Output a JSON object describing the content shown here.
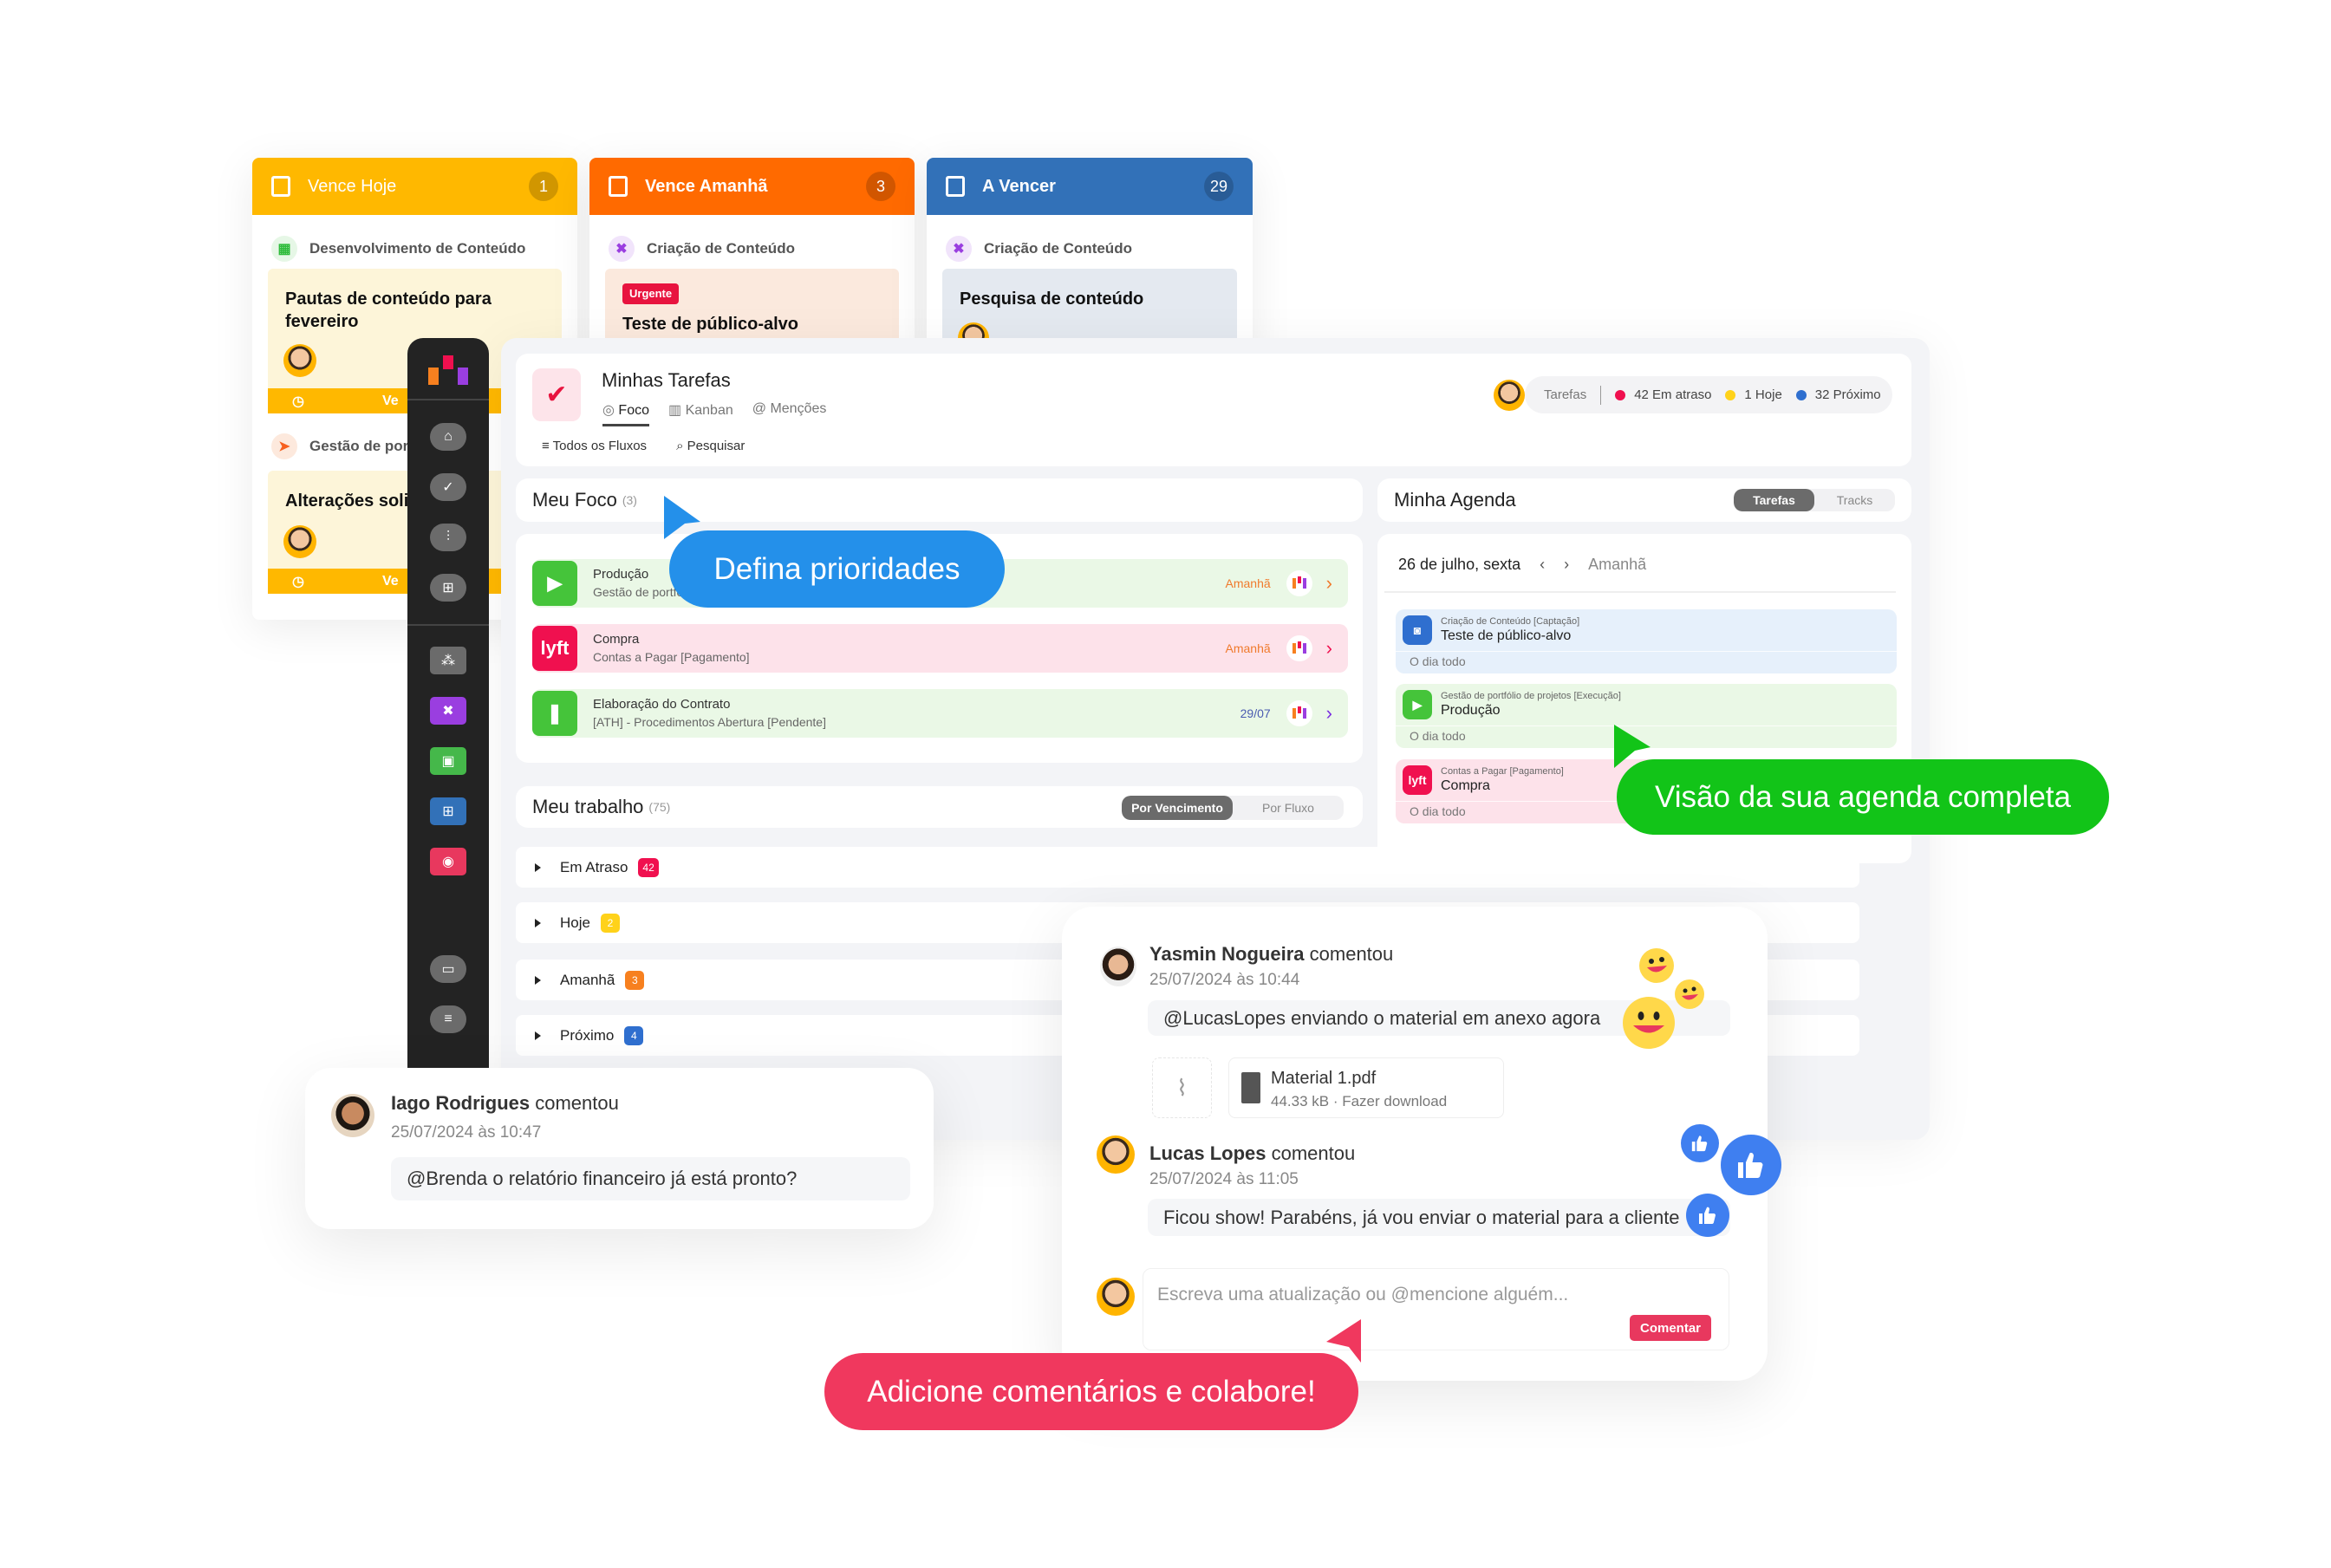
{
  "kanban": {
    "columns": [
      {
        "title": "Vence Hoje",
        "count": "1",
        "color": "#ffb800",
        "groups": [
          {
            "flow": "Desenvolvimento de Conteúdo",
            "card": "Pautas de conteúdo para fevereiro",
            "footer": "Ve"
          },
          {
            "flow": "Gestão de port",
            "card": "Alterações soli",
            "footer": "Ve"
          }
        ]
      },
      {
        "title": "Vence Amanhã",
        "count": "3",
        "color": "#ff6a00",
        "flow": "Criação de Conteúdo",
        "tag": "Urgente",
        "card": "Teste de público-alvo"
      },
      {
        "title": "A Vencer",
        "count": "29",
        "color": "#3271b8",
        "flow": "Criação de Conteúdo",
        "card": "Pesquisa de conteúdo"
      }
    ]
  },
  "sidebar": {
    "icons": [
      "logo-icon",
      "home-icon",
      "check-icon",
      "flows-icon",
      "table-icon",
      "cubes-icon",
      "tools-icon",
      "money-icon",
      "grid-icon",
      "cash-icon",
      "store-icon",
      "menu-icon"
    ]
  },
  "header": {
    "title": "Minhas Tarefas",
    "tabs": [
      {
        "label": "Foco",
        "icon": "◎"
      },
      {
        "label": "Kanban",
        "icon": "▥"
      },
      {
        "label": "Menções",
        "icon": "@"
      }
    ],
    "filters": {
      "flows": "Todos os Fluxos",
      "search": "Pesquisar"
    },
    "stats": {
      "label": "Tarefas",
      "late": "42 Em atraso",
      "today": "1 Hoje",
      "next": "32 Próximo"
    }
  },
  "focus": {
    "title": "Meu Foco",
    "count": "(3)",
    "items": [
      {
        "title": "Produção",
        "sub": "Gestão de portfólio de projetos [Execução]",
        "date": "Amanhã",
        "color": "#45c43a",
        "bg": "#eaf8e6",
        "datecolor": "#f07a2c",
        "chev": "#f07a2c"
      },
      {
        "title": "Compra",
        "sub": "Contas a Pagar [Pagamento]",
        "date": "Amanhã",
        "color": "#f0104f",
        "bg": "#fde2ea",
        "datecolor": "#f07a2c",
        "chev": "#f0104f"
      },
      {
        "title": "Elaboração do Contrato",
        "sub": "[ATH] - Procedimentos Abertura [Pendente]",
        "date": "29/07",
        "color": "#45c43a",
        "bg": "#eaf8e6",
        "datecolor": "#4a5bb0",
        "chev": "#7a2ee0"
      }
    ]
  },
  "work": {
    "title": "Meu trabalho",
    "count": "(75)",
    "toggle": {
      "active": "Por Vencimento",
      "inactive": "Por Fluxo"
    },
    "groups": [
      {
        "label": "Em Atraso",
        "count": "42",
        "color": "#f0104f"
      },
      {
        "label": "Hoje",
        "count": "2",
        "color": "#ffd21a"
      },
      {
        "label": "Amanhã",
        "count": "3",
        "color": "#f7801f"
      },
      {
        "label": "Próximo",
        "count": "4",
        "color": "#2f6fcf"
      }
    ]
  },
  "agenda": {
    "title": "Minha Agenda",
    "toggle": {
      "active": "Tarefas",
      "inactive": "Tracks"
    },
    "date": "26 de julho, sexta",
    "next_label": "Amanhã",
    "events": [
      {
        "flow": "Criação de Conteúdo [Captação]",
        "title": "Teste de público-alvo",
        "time": "O dia todo",
        "color": "#2f6fcf",
        "bg": "#e6f0fb"
      },
      {
        "flow": "Gestão de portfólio de projetos [Execução]",
        "title": "Produção",
        "time": "O dia todo",
        "color": "#45c43a",
        "bg": "#eaf8e6"
      },
      {
        "flow": "Contas a Pagar [Pagamento]",
        "title": "Compra",
        "time": "O dia todo",
        "color": "#f0104f",
        "bg": "#fde2ea"
      }
    ]
  },
  "callouts": {
    "priorities": {
      "text": "Defina prioridades",
      "color": "#2490ea"
    },
    "agenda": {
      "text": "Visão da sua agenda completa",
      "color": "#12c418"
    },
    "comments": {
      "text": "Adicione comentários e colabore!",
      "color": "#f0385e"
    }
  },
  "comments": {
    "left": {
      "author": "Iago Rodrigues",
      "verb": "comentou",
      "date": "25/07/2024 às 10:47",
      "text": "@Brenda o relatório financeiro já está pronto?"
    },
    "thread": [
      {
        "author": "Yasmin Nogueira",
        "verb": "comentou",
        "date": "25/07/2024 às 10:44",
        "text": "@LucasLopes enviando o material em anexo agora"
      },
      {
        "author": "Lucas Lopes",
        "verb": "comentou",
        "date": "25/07/2024 às 11:05",
        "text": "Ficou show! Parabéns, já vou enviar o material para a cliente"
      }
    ],
    "attachment": {
      "name": "Material 1.pdf",
      "meta": "44.33 kB · Fazer download"
    },
    "input_placeholder": "Escreva uma atualização ou @mencione alguém...",
    "submit": "Comentar"
  }
}
